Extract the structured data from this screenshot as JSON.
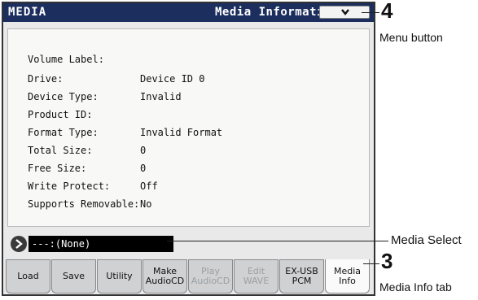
{
  "titlebar": {
    "left": "MEDIA",
    "right": "Media Information"
  },
  "menu_button": {
    "icon": "chevron-down-icon"
  },
  "info": {
    "volume_label": {
      "label": "Volume Label:",
      "value": ""
    },
    "drive": {
      "label": "Drive:",
      "value": "Device ID 0"
    },
    "device_type": {
      "label": "Device Type:",
      "value": "Invalid"
    },
    "product_id": {
      "label": "Product ID:",
      "value": ""
    },
    "format_type": {
      "label": "Format Type:",
      "value": "Invalid Format"
    },
    "total_size": {
      "label": "Total Size:",
      "value": "0"
    },
    "free_size": {
      "label": "Free Size:",
      "value": "0"
    },
    "write_protect": {
      "label": "Write Protect:",
      "value": "Off"
    },
    "supports_removable": {
      "label": "Supports Removable:",
      "value": "No"
    }
  },
  "media_select": {
    "value": "---:(None)"
  },
  "tabs": {
    "load": {
      "line1": "Load",
      "line2": ""
    },
    "save": {
      "line1": "Save",
      "line2": ""
    },
    "utility": {
      "line1": "Utility",
      "line2": ""
    },
    "make_audiocd": {
      "line1": "Make",
      "line2": "AudioCD"
    },
    "play_audiocd": {
      "line1": "Play",
      "line2": "AudioCD"
    },
    "edit_wave": {
      "line1": "Edit",
      "line2": "WAVE"
    },
    "exusb_pcm": {
      "line1": "EX-USB",
      "line2": "PCM"
    },
    "media_info": {
      "line1": "Media",
      "line2": "Info"
    }
  },
  "callouts": {
    "menu_number": "4",
    "menu_label": "Menu button",
    "media_select_label": "Media Select",
    "tab_number": "3",
    "tab_label": "Media Info tab"
  },
  "colors": {
    "titlebar": "#1c2e5e",
    "screen": "#e8e9e8",
    "tab": "#cfd1d2",
    "select": "#000000"
  }
}
